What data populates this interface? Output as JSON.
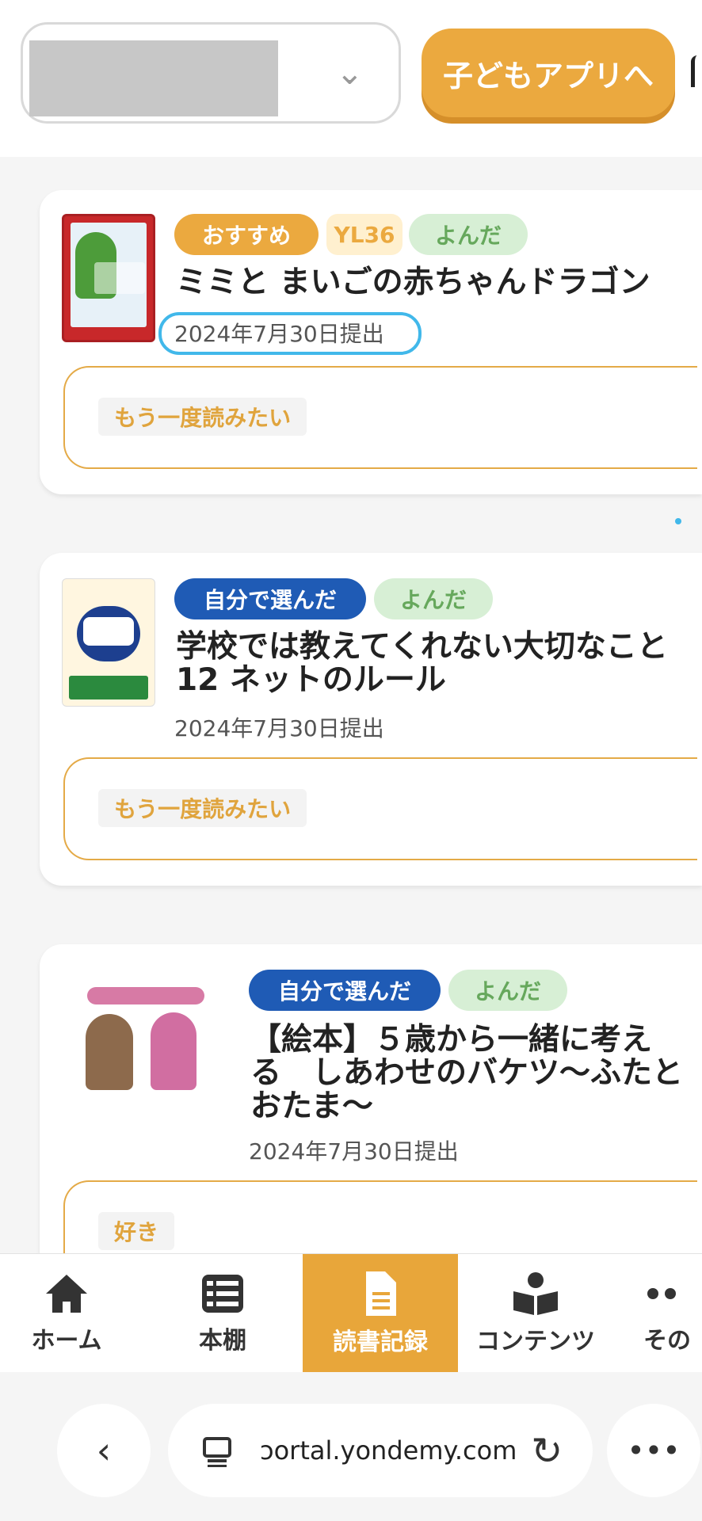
{
  "header": {
    "child_select_value": "",
    "to_app_label": "子どもアプリへ"
  },
  "records": [
    {
      "tags": [
        "おすすめ",
        "YL36",
        "よんだ"
      ],
      "title": "ミミと まいごの赤ちゃんドラゴン",
      "date": "2024年7月30日提出",
      "comment": "もう一度読みたい"
    },
    {
      "tags": [
        "自分で選んだ",
        "よんだ"
      ],
      "title_line1": "学校では教えてくれない大切なこと",
      "title_line2": "12 ネットのルール",
      "date": "2024年7月30日提出",
      "comment": "もう一度読みたい"
    },
    {
      "tags": [
        "自分で選んだ",
        "よんだ"
      ],
      "title_line1": "【絵本】５歳から一緒に考え",
      "title_line2": "る　しあわせのバケツ〜ふたと",
      "title_line3": "おたま〜",
      "date": "2024年7月30日提出",
      "comment": "好き"
    }
  ],
  "bottom_nav": {
    "items": [
      {
        "label": "ホーム",
        "icon": "home-icon"
      },
      {
        "label": "本棚",
        "icon": "bookshelf-icon"
      },
      {
        "label": "読書記録",
        "icon": "document-icon",
        "active": true
      },
      {
        "label": "コンテンツ",
        "icon": "reader-icon"
      },
      {
        "label": "その",
        "icon": "more-icon"
      }
    ]
  },
  "browser": {
    "url": "ɔortal.yondemy.com"
  },
  "colors": {
    "accent": "#eba93f",
    "self_selected": "#1f5bb5",
    "read_tag_bg": "#d7efd5",
    "highlight": "#41b8ea"
  }
}
